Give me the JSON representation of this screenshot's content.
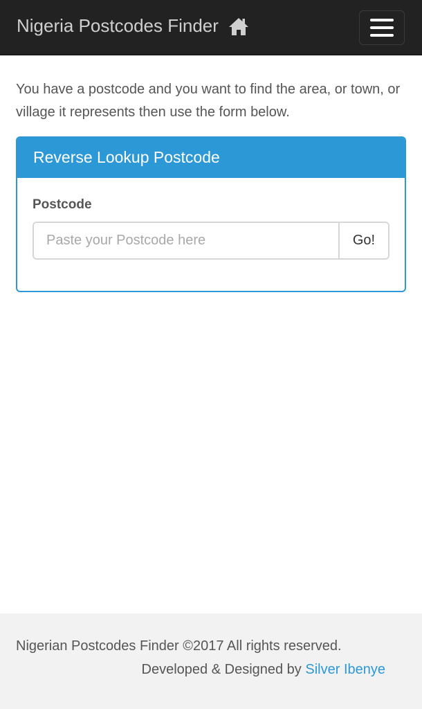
{
  "navbar": {
    "brand": "Nigeria Postcodes Finder",
    "brand_icon": "home-icon",
    "menu_icon": "hamburger-menu-icon"
  },
  "intro": {
    "text": "You have a postcode and you want to find the area, or town, or village it represents then use the form below."
  },
  "lookup_panel": {
    "heading": "Reverse Lookup Postcode",
    "field_label": "Postcode",
    "input_value": "",
    "input_placeholder": "Paste your Postcode here",
    "button_label": "Go!"
  },
  "footer": {
    "copyright": "Nigerian Postcodes Finder ©2017 All rights reserved.",
    "credits_prefix": "Developed & Designed by ",
    "author": "Silver Ibenye"
  },
  "colors": {
    "navbar_bg": "#222222",
    "accent": "#2c98d6",
    "footer_bg": "#f2f2f2",
    "text": "#555555"
  }
}
